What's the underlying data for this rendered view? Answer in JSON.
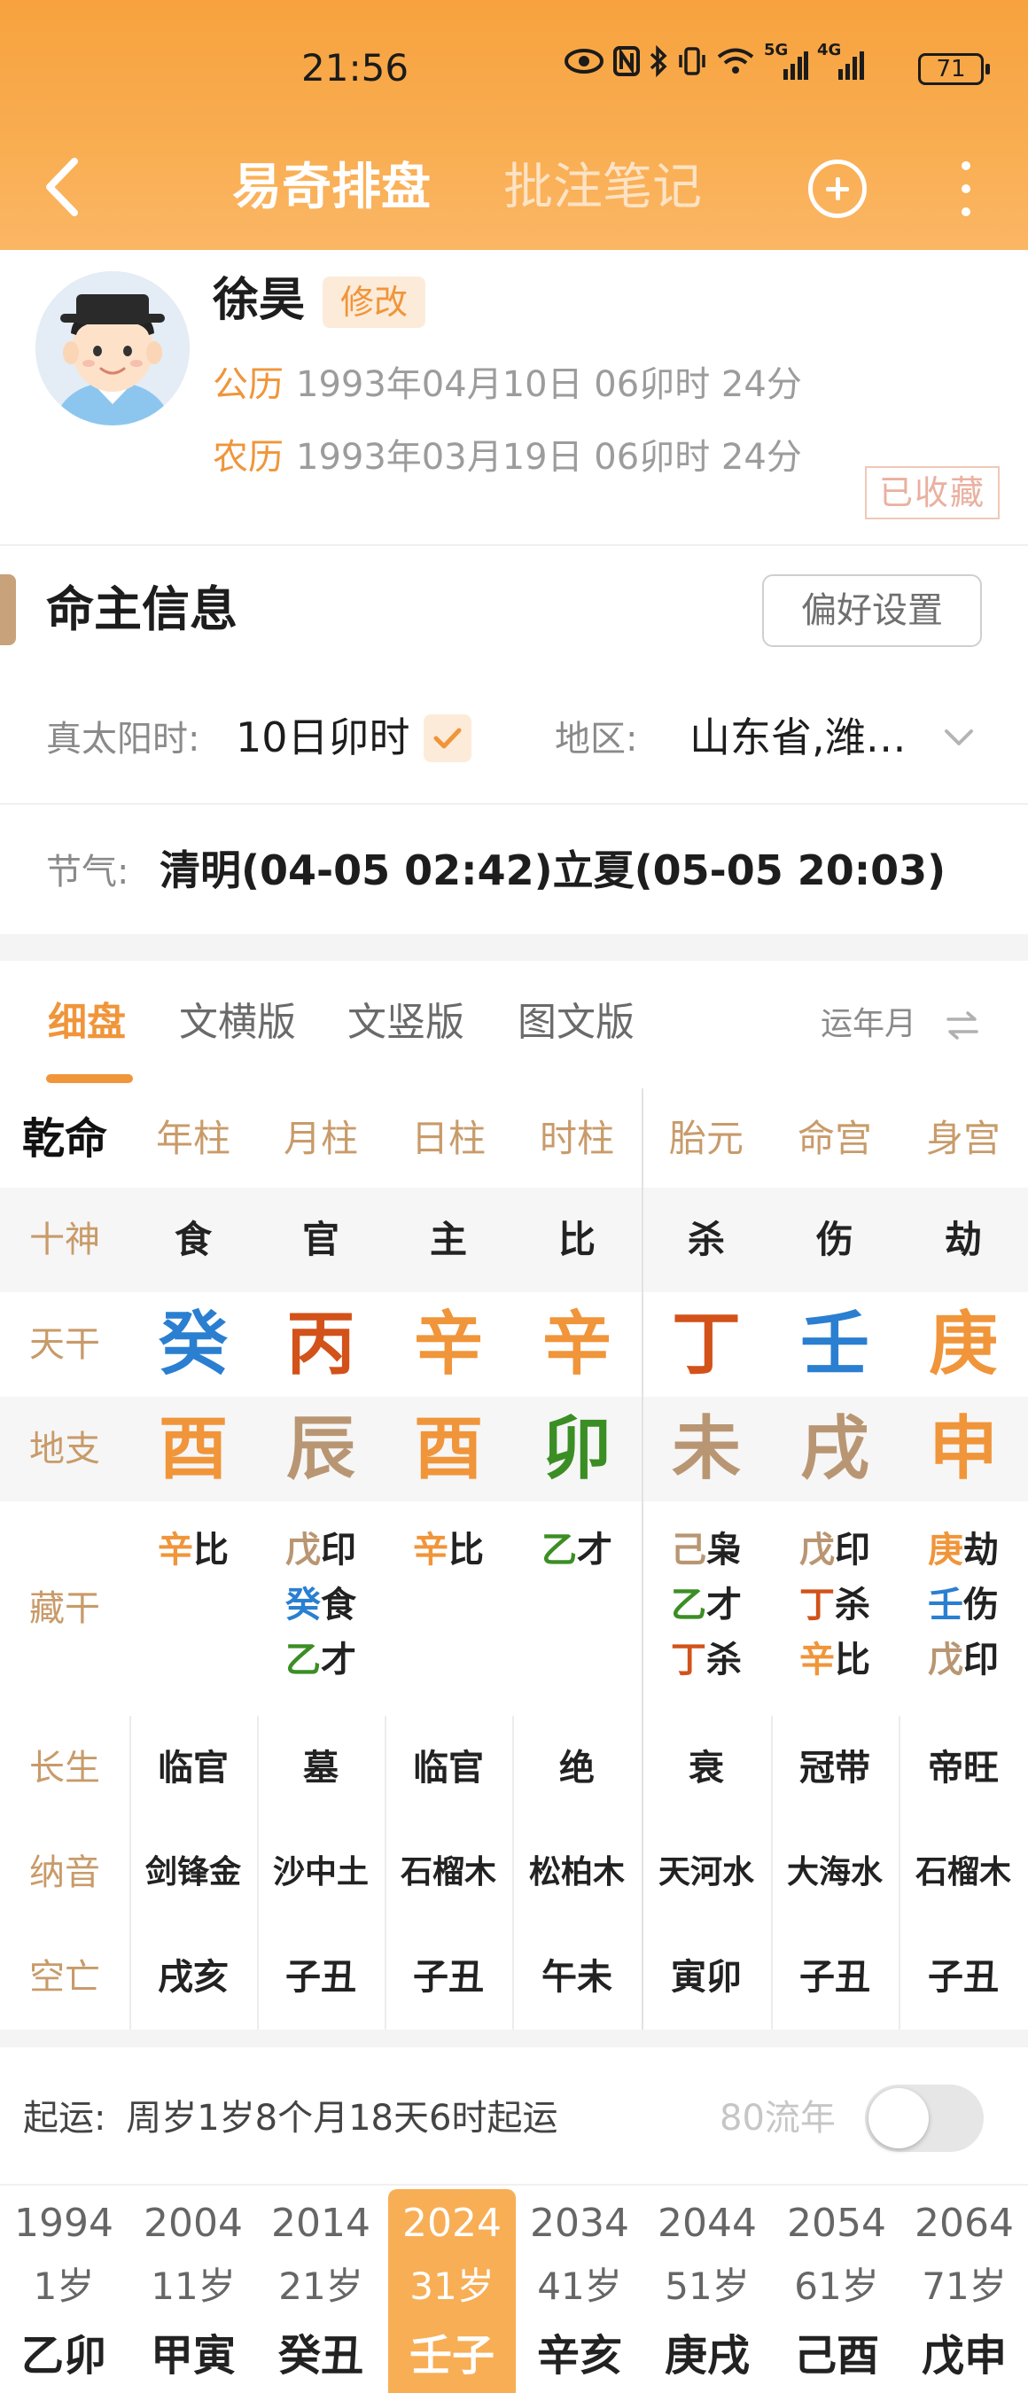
{
  "status_bar": {
    "time": "21:56",
    "battery": "71",
    "net_a": "5G",
    "net_b": "4G"
  },
  "header": {
    "tab_active": "易奇排盘",
    "tab_inactive": "批注笔记"
  },
  "profile": {
    "name": "徐昊",
    "edit_label": "修改",
    "solar_label": "公历",
    "solar_date": "1993年04月10日 06卯时 24分",
    "lunar_label": "农历",
    "lunar_date": "1993年03月19日 06卯时 24分",
    "saved_label": "已收藏"
  },
  "info": {
    "title": "命主信息",
    "pref_button": "偏好设置",
    "true_solar_label": "真太阳时:",
    "true_solar_value": "10日卯时",
    "region_label": "地区:",
    "region_value": "山东省,潍…",
    "jieqi_label": "节气:",
    "jieqi_value": "清明(04-05 02:42)立夏(05-05 20:03)"
  },
  "chart_tabs": {
    "items": [
      "细盘",
      "文横版",
      "文竖版",
      "图文版"
    ],
    "active": "细盘",
    "right_label": "运年月"
  },
  "grid": {
    "corner": "乾命",
    "columns": [
      "年柱",
      "月柱",
      "日柱",
      "时柱",
      "胎元",
      "命宫",
      "身宫"
    ],
    "row_labels": {
      "shishen": "十神",
      "tiangan": "天干",
      "dizhi": "地支",
      "canggan": "藏干",
      "changsheng": "长生",
      "nayin": "纳音",
      "kongwang": "空亡"
    },
    "shishen": [
      "食",
      "官",
      "主",
      "比",
      "杀",
      "伤",
      "劫"
    ],
    "tiangan": [
      "癸",
      "丙",
      "辛",
      "辛",
      "丁",
      "壬",
      "庚"
    ],
    "tiangan_colors": [
      "#2a7fd1",
      "#d2521a",
      "#f0953a",
      "#f0953a",
      "#d2521a",
      "#2a7fd1",
      "#f0953a"
    ],
    "dizhi": [
      "酉",
      "辰",
      "酉",
      "卯",
      "未",
      "戌",
      "申"
    ],
    "dizhi_colors": [
      "#f0953a",
      "#b99673",
      "#f0953a",
      "#3b8e24",
      "#b99673",
      "#b99673",
      "#f0953a"
    ],
    "canggan": [
      [
        {
          "g": "辛",
          "s": "比",
          "c": "#f0953a"
        }
      ],
      [
        {
          "g": "戊",
          "s": "印",
          "c": "#b99673"
        },
        {
          "g": "癸",
          "s": "食",
          "c": "#2a7fd1"
        },
        {
          "g": "乙",
          "s": "才",
          "c": "#3b8e24"
        }
      ],
      [
        {
          "g": "辛",
          "s": "比",
          "c": "#f0953a"
        }
      ],
      [
        {
          "g": "乙",
          "s": "才",
          "c": "#3b8e24"
        }
      ],
      [
        {
          "g": "己",
          "s": "枭",
          "c": "#b99673"
        },
        {
          "g": "乙",
          "s": "才",
          "c": "#3b8e24"
        },
        {
          "g": "丁",
          "s": "杀",
          "c": "#d2521a"
        }
      ],
      [
        {
          "g": "戊",
          "s": "印",
          "c": "#b99673"
        },
        {
          "g": "丁",
          "s": "杀",
          "c": "#d2521a"
        },
        {
          "g": "辛",
          "s": "比",
          "c": "#f0953a"
        }
      ],
      [
        {
          "g": "庚",
          "s": "劫",
          "c": "#f0953a"
        },
        {
          "g": "壬",
          "s": "伤",
          "c": "#2a7fd1"
        },
        {
          "g": "戊",
          "s": "印",
          "c": "#b99673"
        }
      ]
    ],
    "changsheng": [
      "临官",
      "墓",
      "临官",
      "绝",
      "衰",
      "冠带",
      "帝旺"
    ],
    "nayin": [
      "剑锋金",
      "沙中土",
      "石榴木",
      "松柏木",
      "天河水",
      "大海水",
      "石榴木"
    ],
    "kongwang": [
      "戌亥",
      "子丑",
      "子丑",
      "午未",
      "寅卯",
      "子丑",
      "子丑"
    ]
  },
  "qiyun": {
    "label": "起运:",
    "text": "周岁1岁8个月18天6时起运",
    "liunian_label": "80流年"
  },
  "dayun": [
    {
      "year": "1994",
      "age": "1岁",
      "gz": "乙卯",
      "c1": "#3b8e24",
      "c2": "#3b8e24"
    },
    {
      "year": "2004",
      "age": "11岁",
      "gz": "甲寅",
      "c1": "#3b8e24",
      "c2": "#3b8e24"
    },
    {
      "year": "2014",
      "age": "21岁",
      "gz": "癸丑",
      "c1": "#2a7fd1",
      "c2": "#b99673"
    },
    {
      "year": "2024",
      "age": "31岁",
      "gz": "壬子",
      "c1": "#ffffff",
      "c2": "#ffffff",
      "active": true
    },
    {
      "year": "2034",
      "age": "41岁",
      "gz": "辛亥",
      "c1": "#f0953a",
      "c2": "#2a7fd1"
    },
    {
      "year": "2044",
      "age": "51岁",
      "gz": "庚戌",
      "c1": "#f0953a",
      "c2": "#b99673"
    },
    {
      "year": "2054",
      "age": "61岁",
      "gz": "己酉",
      "c1": "#b99673",
      "c2": "#f0953a"
    },
    {
      "year": "2064",
      "age": "71岁",
      "gz": "戊申",
      "c1": "#b99673",
      "c2": "#f0953a"
    }
  ]
}
